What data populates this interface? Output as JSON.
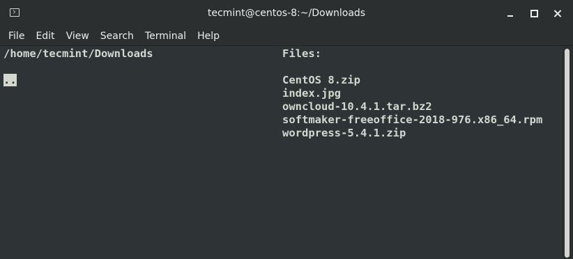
{
  "window": {
    "title": "tecmint@centos-8:~/Downloads"
  },
  "menu": {
    "items": [
      "File",
      "Edit",
      "View",
      "Search",
      "Terminal",
      "Help"
    ]
  },
  "terminal": {
    "current_path": "/home/tecmint/Downloads",
    "files_header": "Files:",
    "parent_dir": "..",
    "files": [
      "CentOS 8.zip",
      "index.jpg",
      "owncloud-10.4.1.tar.bz2",
      "softmaker-freeoffice-2018-976.x86_64.rpm",
      "wordpress-5.4.1.zip"
    ]
  },
  "colors": {
    "background": "#2e3436",
    "titlebar": "#2b2f30",
    "text": "#d3d7cf"
  },
  "icons": {
    "app": "terminal-icon",
    "minimize": "minimize-icon",
    "maximize": "maximize-icon",
    "close": "close-icon"
  }
}
